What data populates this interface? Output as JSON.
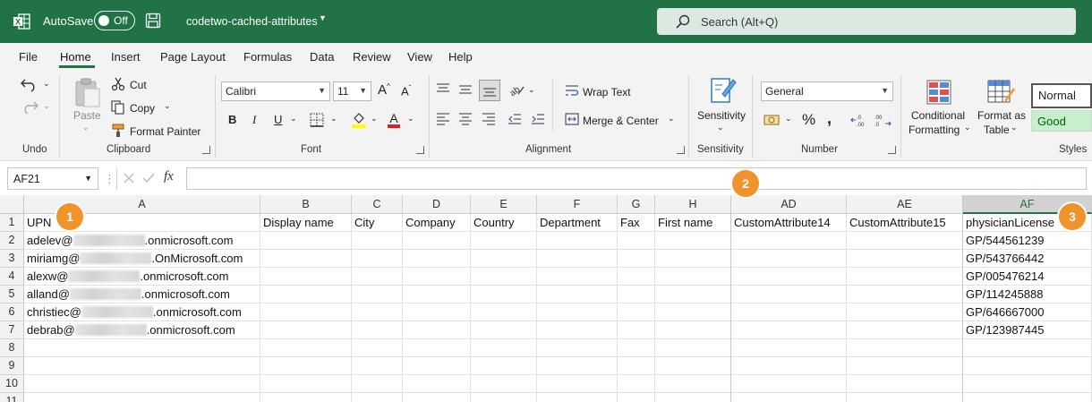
{
  "titlebar": {
    "autosave_label": "AutoSave",
    "autosave_state": "Off",
    "filename": "codetwo-cached-attributes",
    "search_placeholder": "Search (Alt+Q)",
    "accent_color": "#217346"
  },
  "menu": {
    "items": [
      "File",
      "Home",
      "Insert",
      "Page Layout",
      "Formulas",
      "Data",
      "Review",
      "View",
      "Help"
    ],
    "active": "Home"
  },
  "ribbon": {
    "undo": {
      "group_label": "Undo"
    },
    "clipboard": {
      "paste": "Paste",
      "cut": "Cut",
      "copy": "Copy",
      "format_painter": "Format Painter",
      "group_label": "Clipboard"
    },
    "font": {
      "font_name": "Calibri",
      "font_size": "11",
      "bold": "B",
      "italic": "I",
      "underline": "U",
      "group_label": "Font"
    },
    "alignment": {
      "wrap_text": "Wrap Text",
      "merge_center": "Merge & Center",
      "group_label": "Alignment"
    },
    "sensitivity": {
      "button": "Sensitivity",
      "group_label": "Sensitivity"
    },
    "number": {
      "format": "General",
      "percent": "%",
      "comma": "❜",
      "group_label": "Number"
    },
    "styles": {
      "conditional_1": "Conditional",
      "conditional_2": "Formatting",
      "format_table_1": "Format as",
      "format_table_2": "Table",
      "normal": "Normal",
      "good": "Good",
      "group_label": "Styles"
    }
  },
  "formula_bar": {
    "name_box": "AF21",
    "fx": "fx",
    "value": ""
  },
  "sheet": {
    "columns": [
      "A",
      "B",
      "C",
      "D",
      "E",
      "F",
      "G",
      "H",
      "AD",
      "AE",
      "AF"
    ],
    "selected_column": "AF",
    "rows": [
      "1",
      "2",
      "3",
      "4",
      "5",
      "6",
      "7",
      "8",
      "9",
      "10",
      "11"
    ],
    "headers": [
      "UPN",
      "Display name",
      "City",
      "Company",
      "Country",
      "Department",
      "Fax",
      "First name",
      "CustomAttribute14",
      "CustomAttribute15",
      "physicianLicense"
    ],
    "upn_values": [
      {
        "user": "adelev@",
        "domain": ".onmicrosoft.com"
      },
      {
        "user": "miriamg@",
        "domain": ".OnMicrosoft.com"
      },
      {
        "user": "alexw@",
        "domain": ".onmicrosoft.com"
      },
      {
        "user": "alland@",
        "domain": ".onmicrosoft.com"
      },
      {
        "user": "christiec@",
        "domain": ".onmicrosoft.com"
      },
      {
        "user": "debrab@",
        "domain": ".onmicrosoft.com"
      }
    ],
    "license_values": [
      "GP/544561239",
      "GP/543766442",
      "GP/005476214",
      "GP/114245888",
      "GP/646667000",
      "GP/123987445"
    ]
  },
  "callouts": [
    "1",
    "2",
    "3"
  ]
}
